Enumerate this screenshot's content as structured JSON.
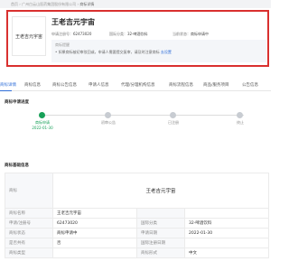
{
  "breadcrumb": {
    "items": [
      "首页",
      "广州白云山医药集团股份有限公司"
    ],
    "current": "商标详情"
  },
  "summary": {
    "logo_text": "王老吉元宇宙",
    "title": "王老吉元宇宙",
    "app_no_label": "申请注册号：",
    "app_no": "62473020",
    "class_label": "国际分类：",
    "class_value": "32-啤酒饮料",
    "status_label": "当前状态：",
    "status_value": "商标申请中",
    "tip_title": "商标提醒",
    "tip_text": "• 如果商标被初审驳回或，申请人需要提交复审，请及时注意商标",
    "tip_link": "去设置"
  },
  "tabs": [
    "商标详情",
    "商标信息",
    "商标公告信息",
    "申请人信息",
    "代理/分理机构信息",
    "商标流程信息",
    "商品/服务项目",
    "公告信息"
  ],
  "progress": {
    "title": "商标申请进度",
    "steps": [
      {
        "label": "商标申请",
        "date": "2022-01-30",
        "done": true
      },
      {
        "label": "初审公告",
        "date": "",
        "done": false
      },
      {
        "label": "已注册",
        "date": "",
        "done": false
      },
      {
        "label": "终止",
        "date": "",
        "done": false
      }
    ]
  },
  "basic": {
    "title": "商标基础信息",
    "image_label": "商标",
    "image_text": "王老吉元宇宙",
    "rows": [
      {
        "k1": "商标名称",
        "v1": "王老吉元宇宙",
        "k2": "",
        "v2": ""
      },
      {
        "k1": "申请/注册号",
        "v1": "62473020",
        "k2": "国际分类",
        "v2": "32-啤酒饮料"
      },
      {
        "k1": "商标状态",
        "v1": "商标申请中",
        "k2": "申请日期",
        "v2": "2022-01-30"
      },
      {
        "k1": "是否共有",
        "v1": "否",
        "k2": "国际注册日期",
        "v2": ""
      },
      {
        "k1": "商标类型",
        "v1": "",
        "k2": "商标形式",
        "v2": "中文"
      }
    ]
  },
  "colors": {
    "accent": "#2f6ed8",
    "highlight": "#d9302f",
    "success": "#18a058"
  }
}
